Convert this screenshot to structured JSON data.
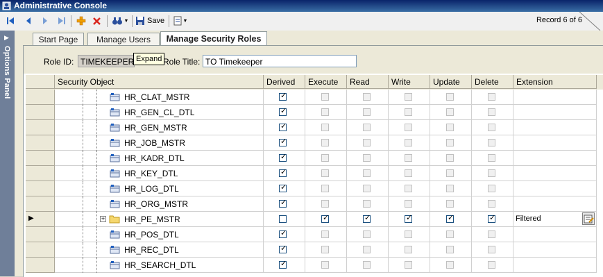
{
  "window": {
    "title": "Administrative Console"
  },
  "toolbar": {
    "save_label": "Save",
    "record_status": "Record 6 of 6",
    "buttons": [
      "first-record",
      "previous-record",
      "next-record",
      "last-record",
      "add-record",
      "delete-record",
      "find",
      "save",
      "options-menu"
    ]
  },
  "side_panel": {
    "label": "Options Panel"
  },
  "tabs": [
    {
      "label": "Start Page",
      "active": false
    },
    {
      "label": "Manage Users",
      "active": false
    },
    {
      "label": "Manage Security Roles",
      "active": true
    }
  ],
  "form": {
    "role_id_label": "Role ID:",
    "role_id_value": "TIMEKEEPER",
    "role_title_label": "Role Title:",
    "role_title_value": "TO Timekeeper",
    "tooltip": "Expand"
  },
  "grid": {
    "columns": [
      "Security Object",
      "Derived",
      "Execute",
      "Read",
      "Write",
      "Update",
      "Delete",
      "Extension"
    ],
    "rows": [
      {
        "object": "HR_CLAT_MSTR",
        "type": "table",
        "derived": true,
        "execute": false,
        "read": false,
        "write": false,
        "update": false,
        "delete": false,
        "extension": "",
        "enabled": false,
        "current": false
      },
      {
        "object": "HR_GEN_CL_DTL",
        "type": "table",
        "derived": true,
        "execute": false,
        "read": false,
        "write": false,
        "update": false,
        "delete": false,
        "extension": "",
        "enabled": false,
        "current": false
      },
      {
        "object": "HR_GEN_MSTR",
        "type": "table",
        "derived": true,
        "execute": false,
        "read": false,
        "write": false,
        "update": false,
        "delete": false,
        "extension": "",
        "enabled": false,
        "current": false
      },
      {
        "object": "HR_JOB_MSTR",
        "type": "table",
        "derived": true,
        "execute": false,
        "read": false,
        "write": false,
        "update": false,
        "delete": false,
        "extension": "",
        "enabled": false,
        "current": false
      },
      {
        "object": "HR_KADR_DTL",
        "type": "table",
        "derived": true,
        "execute": false,
        "read": false,
        "write": false,
        "update": false,
        "delete": false,
        "extension": "",
        "enabled": false,
        "current": false
      },
      {
        "object": "HR_KEY_DTL",
        "type": "table",
        "derived": true,
        "execute": false,
        "read": false,
        "write": false,
        "update": false,
        "delete": false,
        "extension": "",
        "enabled": false,
        "current": false
      },
      {
        "object": "HR_LOG_DTL",
        "type": "table",
        "derived": true,
        "execute": false,
        "read": false,
        "write": false,
        "update": false,
        "delete": false,
        "extension": "",
        "enabled": false,
        "current": false
      },
      {
        "object": "HR_ORG_MSTR",
        "type": "table",
        "derived": true,
        "execute": false,
        "read": false,
        "write": false,
        "update": false,
        "delete": false,
        "extension": "",
        "enabled": false,
        "current": false
      },
      {
        "object": "HR_PE_MSTR",
        "type": "folder",
        "derived": false,
        "execute": true,
        "read": true,
        "write": true,
        "update": true,
        "delete": true,
        "extension": "Filtered",
        "enabled": true,
        "current": true
      },
      {
        "object": "HR_POS_DTL",
        "type": "table",
        "derived": true,
        "execute": false,
        "read": false,
        "write": false,
        "update": false,
        "delete": false,
        "extension": "",
        "enabled": false,
        "current": false
      },
      {
        "object": "HR_REC_DTL",
        "type": "table",
        "derived": true,
        "execute": false,
        "read": false,
        "write": false,
        "update": false,
        "delete": false,
        "extension": "",
        "enabled": false,
        "current": false
      },
      {
        "object": "HR_SEARCH_DTL",
        "type": "table",
        "derived": true,
        "execute": false,
        "read": false,
        "write": false,
        "update": false,
        "delete": false,
        "extension": "",
        "enabled": false,
        "current": false
      }
    ]
  },
  "colors": {
    "titlebar": "#0a246a",
    "side_panel": "#6f7f99",
    "toolbar": "#f0f0f0",
    "grid_line": "#d0d0d0"
  }
}
